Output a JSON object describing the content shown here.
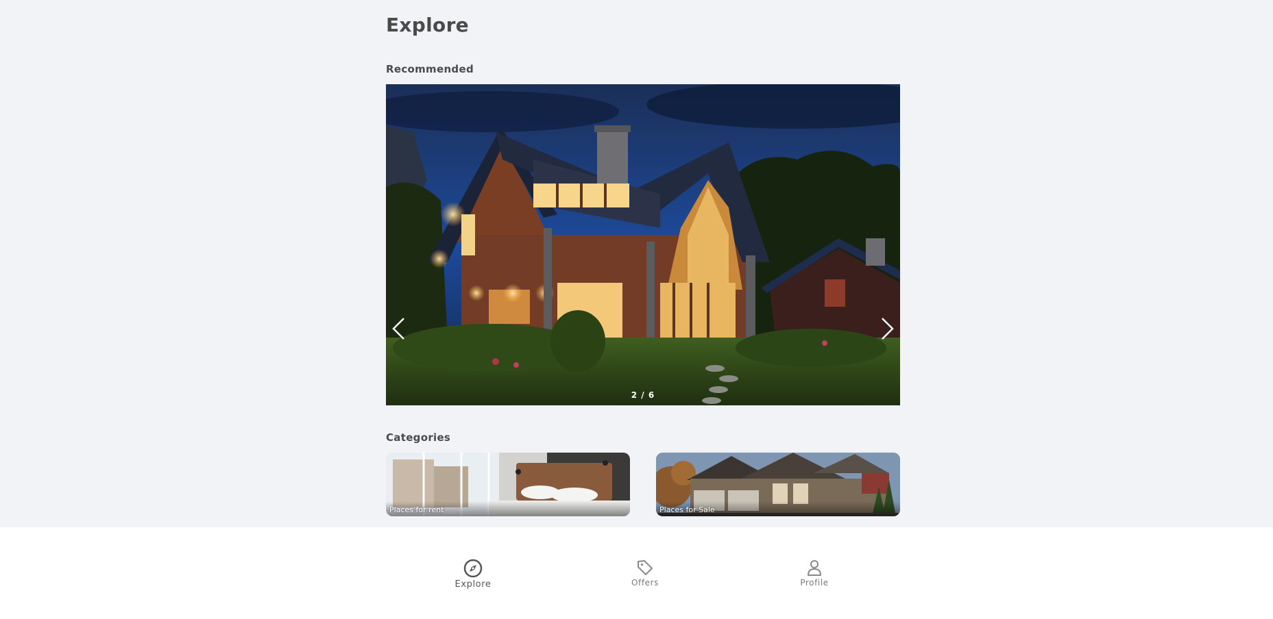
{
  "header": {
    "title": "Explore"
  },
  "recommended": {
    "title": "Recommended",
    "counter": "2 / 6",
    "prev_icon": "chevron-left-icon",
    "next_icon": "chevron-right-icon"
  },
  "categories": {
    "title": "Categories",
    "items": [
      {
        "label": "Places for rent"
      },
      {
        "label": "Places for Sale"
      }
    ]
  },
  "nav": {
    "items": [
      {
        "label": "Explore",
        "icon": "compass-icon",
        "active": true
      },
      {
        "label": "Offers",
        "icon": "tag-icon",
        "active": false
      },
      {
        "label": "Profile",
        "icon": "user-icon",
        "active": false
      }
    ]
  },
  "colors": {
    "background": "#f1f3f6",
    "nav_background": "#ffffff",
    "text_primary": "#4a4a4a",
    "text_muted": "#7a7a7a"
  }
}
